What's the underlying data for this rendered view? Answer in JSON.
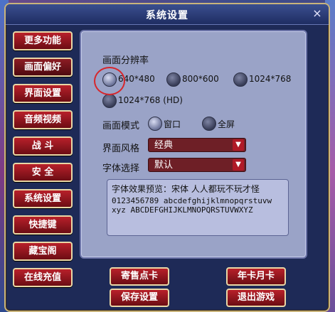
{
  "window": {
    "title": "系统设置",
    "close_icon": "×"
  },
  "sidebar": {
    "items": [
      {
        "label": "更多功能"
      },
      {
        "label": "画面偏好"
      },
      {
        "label": "界面设置"
      },
      {
        "label": "音频视频"
      },
      {
        "label": "战 斗"
      },
      {
        "label": "安 全"
      },
      {
        "label": "系统设置"
      },
      {
        "label": "快捷键"
      },
      {
        "label": "藏宝阁"
      },
      {
        "label": "在线充值"
      }
    ]
  },
  "resolution": {
    "label": "画面分辨率",
    "options": [
      {
        "label": "640*480",
        "selected": true
      },
      {
        "label": "800*600",
        "selected": false
      },
      {
        "label": "1024*768",
        "selected": false
      },
      {
        "label": "1024*768 (HD)",
        "selected": false
      }
    ]
  },
  "display_mode": {
    "label": "画面模式",
    "options": [
      {
        "label": "窗口",
        "selected": true
      },
      {
        "label": "全屏",
        "selected": false
      }
    ]
  },
  "ui_style": {
    "label": "界面风格",
    "value": "经典",
    "arrow_icon": "▼"
  },
  "font_select": {
    "label": "字体选择",
    "value": "默认",
    "arrow_icon": "▼"
  },
  "preview": {
    "line1": "字体效果预览：宋体 人人都玩不玩才怪",
    "line2": "0123456789 abcdefghijklmnopqrstuvw",
    "line3": "xyz ABCDEFGHIJKLMNOPQRSTUVWXYZ"
  },
  "bottom_buttons": {
    "sell_card": "寄售点卡",
    "year_card": "年卡月卡",
    "save": "保存设置",
    "exit": "退出游戏"
  }
}
